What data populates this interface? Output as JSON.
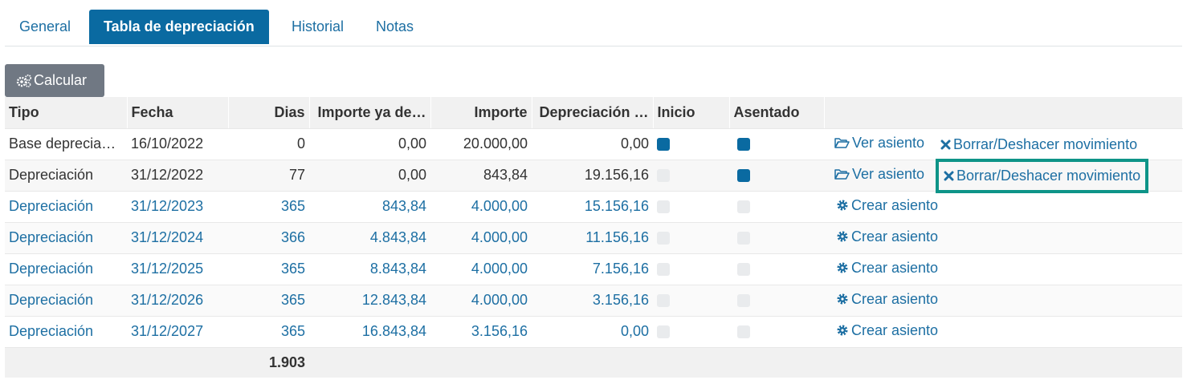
{
  "tabs": [
    {
      "label": "General"
    },
    {
      "label": "Tabla de depreciación"
    },
    {
      "label": "Historial"
    },
    {
      "label": "Notas"
    }
  ],
  "toolbar": {
    "calculate_label": "Calcular"
  },
  "table": {
    "headers": [
      "Tipo",
      "Fecha",
      "Dias",
      "Importe ya de…",
      "Importe",
      "Depreciación …",
      "Inicio",
      "Asentado",
      ""
    ],
    "rows": [
      {
        "tipo": "Base depreciación…",
        "fecha": "16/10/2022",
        "dias": "0",
        "importe_ya": "0,00",
        "importe": "20.000,00",
        "depreciacion": "0,00",
        "inicio": true,
        "asentado": true,
        "action": "Ver asiento",
        "delete": "Borrar/Deshacer movimiento"
      },
      {
        "tipo": "Depreciación",
        "fecha": "31/12/2022",
        "dias": "77",
        "importe_ya": "0,00",
        "importe": "843,84",
        "depreciacion": "19.156,16",
        "inicio": false,
        "asentado": true,
        "action": "Ver asiento",
        "delete": "Borrar/Deshacer movimiento"
      },
      {
        "tipo": "Depreciación",
        "fecha": "31/12/2023",
        "dias": "365",
        "importe_ya": "843,84",
        "importe": "4.000,00",
        "depreciacion": "15.156,16",
        "inicio": false,
        "asentado": false,
        "action": "Crear asiento"
      },
      {
        "tipo": "Depreciación",
        "fecha": "31/12/2024",
        "dias": "366",
        "importe_ya": "4.843,84",
        "importe": "4.000,00",
        "depreciacion": "11.156,16",
        "inicio": false,
        "asentado": false,
        "action": "Crear asiento"
      },
      {
        "tipo": "Depreciación",
        "fecha": "31/12/2025",
        "dias": "365",
        "importe_ya": "8.843,84",
        "importe": "4.000,00",
        "depreciacion": "7.156,16",
        "inicio": false,
        "asentado": false,
        "action": "Crear asiento"
      },
      {
        "tipo": "Depreciación",
        "fecha": "31/12/2026",
        "dias": "365",
        "importe_ya": "12.843,84",
        "importe": "4.000,00",
        "depreciacion": "3.156,16",
        "inicio": false,
        "asentado": false,
        "action": "Crear asiento"
      },
      {
        "tipo": "Depreciación",
        "fecha": "31/12/2027",
        "dias": "365",
        "importe_ya": "16.843,84",
        "importe": "3.156,16",
        "depreciacion": "0,00",
        "inicio": false,
        "asentado": false,
        "action": "Crear asiento"
      }
    ],
    "footer": {
      "dias_total": "1.903"
    }
  },
  "colors": {
    "accent": "#0a6aa1",
    "link": "#1d6fa3",
    "highlight": "#0e9488",
    "button": "#707883"
  }
}
